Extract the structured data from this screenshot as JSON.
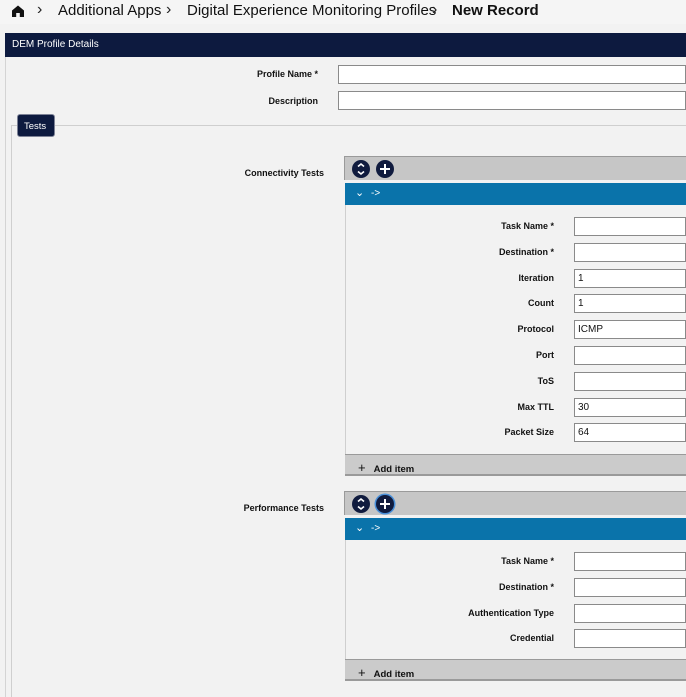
{
  "breadcrumb": {
    "items": [
      "Additional Apps",
      "Digital Experience Monitoring Profiles",
      "New Record"
    ]
  },
  "section": {
    "title": "DEM Profile Details"
  },
  "profile": {
    "name_label": "Profile Name *",
    "name_value": "",
    "description_label": "Description",
    "description_value": ""
  },
  "tabs": {
    "tests": "Tests"
  },
  "connectivity": {
    "label": "Connectivity Tests",
    "row_label": "->",
    "fields": [
      {
        "label": "Task Name *",
        "value": ""
      },
      {
        "label": "Destination *",
        "value": ""
      },
      {
        "label": "Iteration",
        "value": "1"
      },
      {
        "label": "Count",
        "value": "1"
      },
      {
        "label": "Protocol",
        "value": "ICMP"
      },
      {
        "label": "Port",
        "value": ""
      },
      {
        "label": "ToS",
        "value": ""
      },
      {
        "label": "Max TTL",
        "value": "30"
      },
      {
        "label": "Packet Size",
        "value": "64"
      }
    ],
    "add_label": "Add item"
  },
  "performance": {
    "label": "Performance Tests",
    "row_label": "->",
    "fields": [
      {
        "label": "Task Name *",
        "value": ""
      },
      {
        "label": "Destination *",
        "value": ""
      },
      {
        "label": "Authentication Type",
        "value": ""
      },
      {
        "label": "Credential",
        "value": ""
      }
    ],
    "add_label": "Add item"
  },
  "icons": {
    "home": "home-icon",
    "collapse": "collapse-all-icon",
    "add": "plus-circle-icon",
    "chevron": "chevron-down-icon"
  }
}
